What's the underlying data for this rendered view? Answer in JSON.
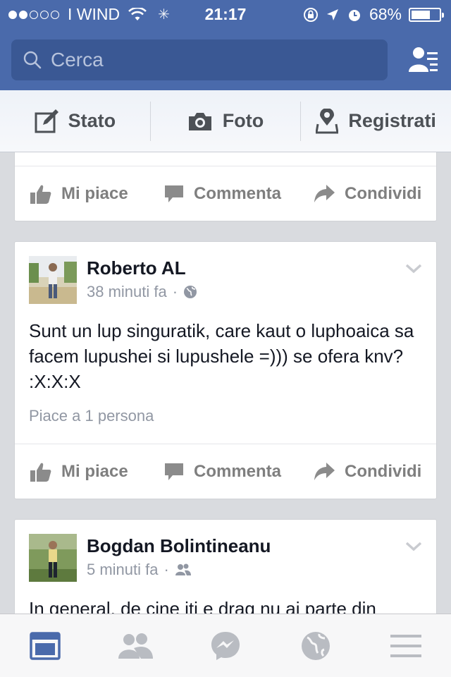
{
  "status_bar": {
    "signal_dots_filled": 2,
    "signal_dots_total": 5,
    "carrier": "I WIND",
    "time": "21:17",
    "battery": "68%",
    "battery_level": 0.68
  },
  "search": {
    "placeholder": "Cerca"
  },
  "composer": {
    "status_label": "Stato",
    "photo_label": "Foto",
    "checkin_label": "Registrati"
  },
  "actions": {
    "like": "Mi piace",
    "comment": "Commenta",
    "share": "Condividi"
  },
  "posts": [
    {
      "author": "Roberto AL",
      "time": "38 minuti fa",
      "privacy": "globe-icon",
      "text": "Sunt un lup singuratik, care kaut o luphoaica sa facem lupushei si lupushele =))) se ofera knv? :X:X:X",
      "likes": "Piace a 1 persona"
    },
    {
      "author": "Bogdan Bolintineanu",
      "time": "5 minuti fa",
      "privacy": "friends-icon",
      "text": "In general, de cine iti e drag nu ai parte din"
    }
  ],
  "colors": {
    "header": "#4a6aab",
    "search_bg": "#3a5894",
    "active_tab": "#4a6aab",
    "action_gray": "#7f7f7f"
  },
  "tabbar": {
    "active": "news-feed-icon",
    "tabs": [
      "news-feed-icon",
      "friend-requests-icon",
      "messenger-icon",
      "notifications-globe-icon",
      "menu-icon"
    ]
  }
}
